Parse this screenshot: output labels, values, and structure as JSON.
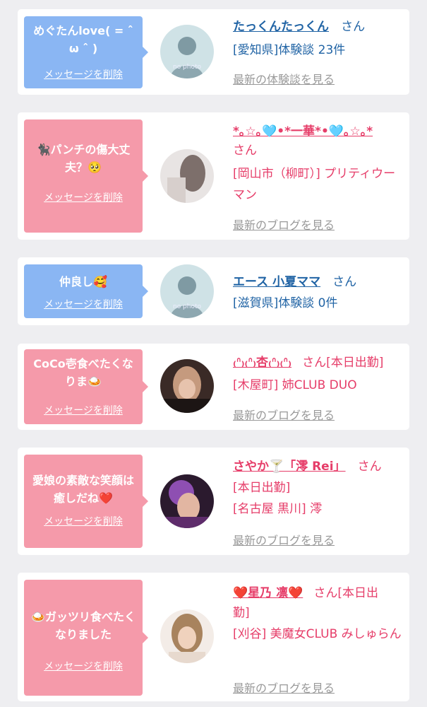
{
  "delete_label": "メッセージを削除",
  "colors": {
    "blue_bubble": "#8ab6f3",
    "pink_bubble": "#f59aaa",
    "blue_text": "#2164a5",
    "pink_text": "#e63d69",
    "link_gray": "#999999"
  },
  "cards": [
    {
      "bubble_color": "blue",
      "message": "めぐたんlove( = ˆ ω ˆ )",
      "avatar": "no-photo-icon",
      "name": "たっくんたっくん",
      "san": "さん",
      "meta1": "[愛知県]体験談 23件",
      "link": "最新の体験談を見る"
    },
    {
      "bubble_color": "pink",
      "message": "🐈‍⬛パンチの傷大丈夫？🥺",
      "avatar": "photo",
      "name": "*｡☆｡🩵•*一華*•🩵｡☆｡*",
      "san": "さん",
      "meta1": "[岡山市（柳町）] プリティウーマン",
      "link": "最新のブログを見る"
    },
    {
      "bubble_color": "blue",
      "message": "仲良し🥰",
      "avatar": "no-photo-icon",
      "name": "エース 小夏ママ",
      "san": "さん",
      "meta1": "[滋賀県]体験談 0件",
      "link": "最新の体験談を見る"
    },
    {
      "bubble_color": "pink",
      "message": "CoCo壱食べたくなりま🍛",
      "avatar": "photo",
      "name": "₍ᐢ₎₍ᐢ₎杏₍ᐢ₎₍ᐢ₎",
      "san": "さん[本日出勤]",
      "meta1": "[木屋町] 姉CLUB DUO",
      "link": "最新のブログを見る"
    },
    {
      "bubble_color": "pink",
      "message": "愛娘の素敵な笑顔は癒しだね❤️",
      "avatar": "photo",
      "name": "さやか🍸「澪 Rei」",
      "san": "さん",
      "meta1": "[本日出勤]",
      "meta2": "[名古屋 黒川] 澪",
      "link": "最新のブログを見る"
    },
    {
      "bubble_color": "pink",
      "message": "🍛ガッツリ食べたくなりました",
      "avatar": "photo",
      "name": "❤️星乃 凛❤️",
      "san": "さん[本日出",
      "meta1": "勤]",
      "meta2": "[刈谷] 美魔女CLUB みしゅらん",
      "link": "最新のブログを見る"
    }
  ]
}
